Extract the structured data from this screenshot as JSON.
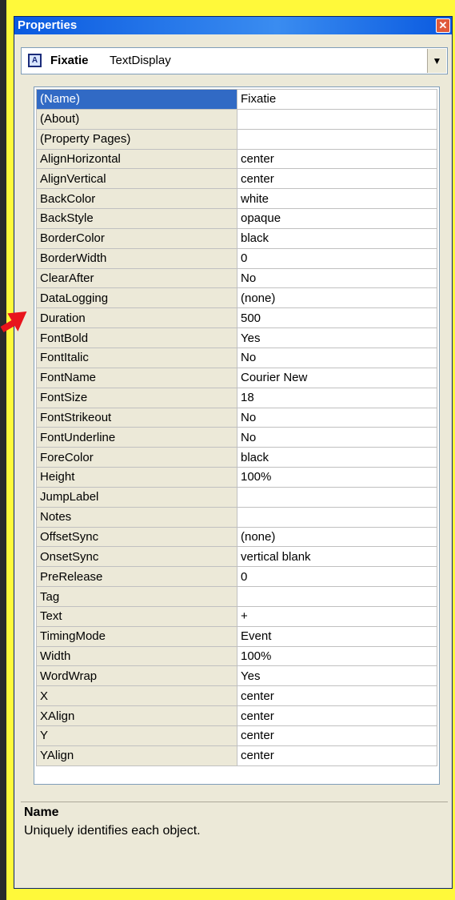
{
  "window": {
    "title": "Properties",
    "close_glyph": "✕"
  },
  "object": {
    "name": "Fixatie",
    "type": "TextDisplay",
    "icon": "text-display-icon"
  },
  "properties": [
    {
      "key": "(Name)",
      "value": "Fixatie"
    },
    {
      "key": "(About)",
      "value": ""
    },
    {
      "key": "(Property Pages)",
      "value": ""
    },
    {
      "key": "AlignHorizontal",
      "value": "center"
    },
    {
      "key": "AlignVertical",
      "value": "center"
    },
    {
      "key": "BackColor",
      "value": "white"
    },
    {
      "key": "BackStyle",
      "value": "opaque"
    },
    {
      "key": "BorderColor",
      "value": "black"
    },
    {
      "key": "BorderWidth",
      "value": "0"
    },
    {
      "key": "ClearAfter",
      "value": "No"
    },
    {
      "key": "DataLogging",
      "value": "(none)"
    },
    {
      "key": "Duration",
      "value": "500"
    },
    {
      "key": "FontBold",
      "value": "Yes"
    },
    {
      "key": "FontItalic",
      "value": "No"
    },
    {
      "key": "FontName",
      "value": "Courier New"
    },
    {
      "key": "FontSize",
      "value": "18"
    },
    {
      "key": "FontStrikeout",
      "value": "No"
    },
    {
      "key": "FontUnderline",
      "value": "No"
    },
    {
      "key": "ForeColor",
      "value": "black"
    },
    {
      "key": "Height",
      "value": "100%"
    },
    {
      "key": "JumpLabel",
      "value": ""
    },
    {
      "key": "Notes",
      "value": ""
    },
    {
      "key": "OffsetSync",
      "value": "(none)"
    },
    {
      "key": "OnsetSync",
      "value": "vertical blank"
    },
    {
      "key": "PreRelease",
      "value": "0"
    },
    {
      "key": "Tag",
      "value": ""
    },
    {
      "key": "Text",
      "value": "+"
    },
    {
      "key": "TimingMode",
      "value": "Event"
    },
    {
      "key": "Width",
      "value": "100%"
    },
    {
      "key": "WordWrap",
      "value": "Yes"
    },
    {
      "key": "X",
      "value": "center"
    },
    {
      "key": "XAlign",
      "value": "center"
    },
    {
      "key": "Y",
      "value": "center"
    },
    {
      "key": "YAlign",
      "value": "center"
    }
  ],
  "selected_index": 0,
  "description": {
    "heading": "Name",
    "text": "Uniquely identifies each object."
  },
  "colors": {
    "title_bar": "#0a5ae0",
    "selection": "#316ac5",
    "annotation_arrow": "#e8141c",
    "slide_bg": "#fff93a"
  },
  "dropdown_icon": "chevron-down-icon"
}
